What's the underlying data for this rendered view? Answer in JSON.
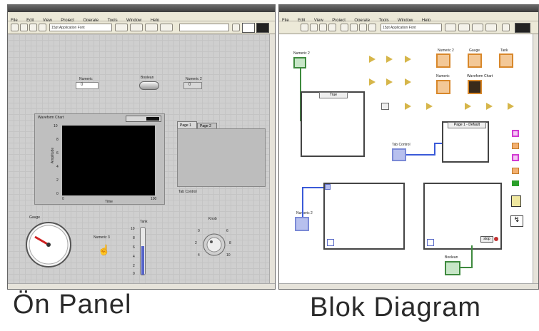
{
  "menu": [
    "File",
    "Edit",
    "View",
    "Project",
    "Operate",
    "Tools",
    "Window",
    "Help"
  ],
  "toolbar": {
    "font": "15pt Application Font"
  },
  "front_panel": {
    "numeric1_label": "Numeric",
    "numeric1_value": "0",
    "boolean_label": "Boolean",
    "numeric2_label": "Numeric 2",
    "numeric2_value": "0",
    "chart_title": "Waveform Chart",
    "chart_xlabel": "Time",
    "chart_ylabel": "Amplitude",
    "chart_y_ticks": [
      "10",
      "8",
      "6",
      "4",
      "2",
      "0"
    ],
    "chart_x_ticks": [
      "0",
      "100"
    ],
    "tabs": [
      "Page 1",
      "Page 2"
    ],
    "tab_label": "Tab Control",
    "gauge_label": "Gauge",
    "slide_label": "Numeric 3",
    "tank_label": "Tank",
    "tank_ticks": [
      "10",
      "8",
      "6",
      "4",
      "2",
      "0"
    ],
    "knob_label": "Knob",
    "knob_ticks": [
      "0",
      "2",
      "4",
      "6",
      "8",
      "10"
    ]
  },
  "block_diagram": {
    "numeric_label": "Numeric 2",
    "numeric2_label": "Numeric 2",
    "gauge_label": "Gauge",
    "tank_label": "Tank",
    "chart_label": "Waveform Chart",
    "case_selector": "True",
    "tab_label": "Tab Control",
    "tab_case": "Page 1 - Default",
    "boolean_label": "Boolean",
    "numeric3_label": "Numeric",
    "stop_label": "stop"
  },
  "captions": {
    "left": "Ön Panel",
    "right": "Blok Diagram"
  },
  "colors": {
    "fp_grid": "#cfcfcf",
    "bd_bg": "#ffffff",
    "wire": "#3a5ad8",
    "chart_bg": "#000000"
  }
}
